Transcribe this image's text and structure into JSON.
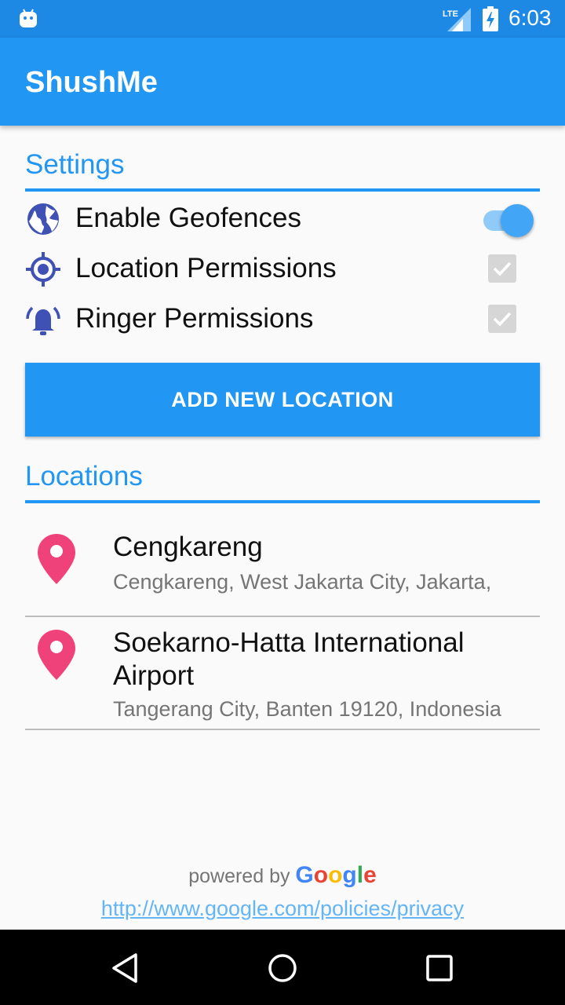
{
  "status_bar": {
    "time": "6:03",
    "network": "LTE",
    "icons": [
      "android-icon",
      "lte-signal-icon",
      "battery-charging-icon"
    ]
  },
  "app_bar": {
    "title": "ShushMe"
  },
  "settings": {
    "section_title": "Settings",
    "rows": [
      {
        "label": "Enable Geofences",
        "icon": "globe-icon",
        "control": "toggle",
        "checked": true
      },
      {
        "label": "Location Permissions",
        "icon": "gps-target-icon",
        "control": "checkbox",
        "checked": true,
        "disabled": true
      },
      {
        "label": "Ringer Permissions",
        "icon": "ringing-bell-icon",
        "control": "checkbox",
        "checked": true,
        "disabled": true
      }
    ]
  },
  "add_button": {
    "label": "ADD NEW LOCATION"
  },
  "locations": {
    "section_title": "Locations",
    "items": [
      {
        "name": "Cengkareng",
        "address": "Cengkareng, West Jakarta City, Jakarta,"
      },
      {
        "name": "Soekarno-Hatta International Airport",
        "address": "Tangerang City, Banten 19120, Indonesia"
      }
    ]
  },
  "footer": {
    "powered_by": "powered by",
    "google_letters": [
      "G",
      "o",
      "o",
      "g",
      "l",
      "e"
    ],
    "privacy_link": "http://www.google.com/policies/privacy"
  },
  "colors": {
    "primary": "#2196f3",
    "primary_dark": "#1e88e5",
    "pin": "#f0427a",
    "icon_indigo": "#3f51b5"
  }
}
